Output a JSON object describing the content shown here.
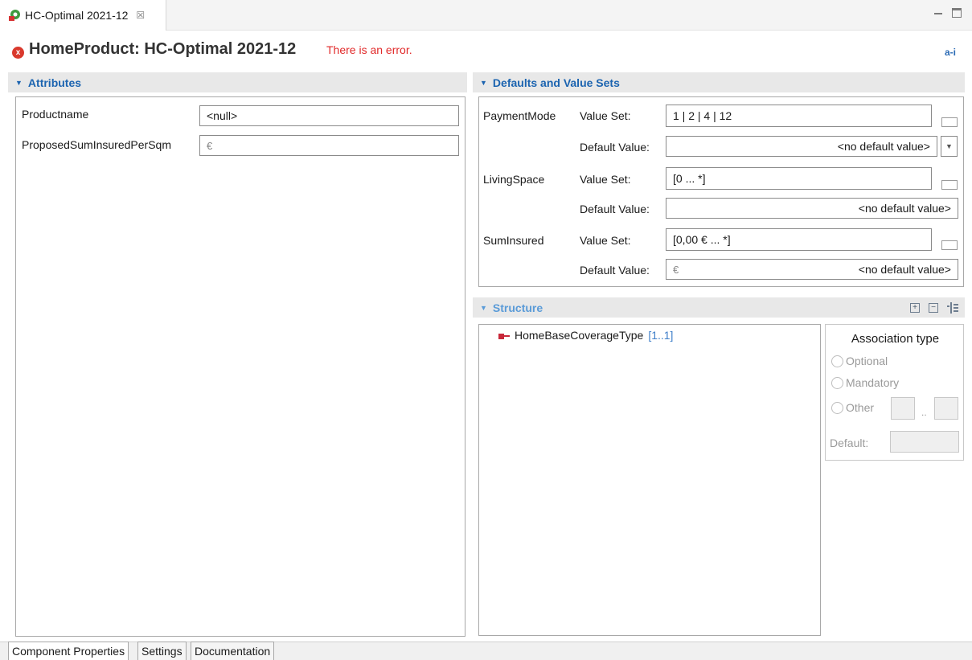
{
  "editor_tab": {
    "title": "HC-Optimal 2021-12",
    "close": "☒"
  },
  "header": {
    "title": "HomeProduct: HC-Optimal 2021-12",
    "error": "There is an error.",
    "error_icon": "x",
    "info_icon": "a-i"
  },
  "attributes": {
    "section_title": "Attributes",
    "rows": [
      {
        "label": "Productname",
        "value": "<null>",
        "unit": ""
      },
      {
        "label": "ProposedSumInsuredPerSqm",
        "value": "",
        "unit": "€"
      }
    ]
  },
  "defaults": {
    "section_title": "Defaults and Value Sets",
    "value_set_label": "Value Set:",
    "default_value_label": "Default Value:",
    "rows": [
      {
        "name": "PaymentMode",
        "value_set": "1 | 2 | 4 | 12",
        "default_value": "<no default value>",
        "default_unit": "",
        "has_dropdown": true
      },
      {
        "name": "LivingSpace",
        "value_set": "[0 ... *]",
        "default_value": "<no default value>",
        "default_unit": "",
        "has_dropdown": false
      },
      {
        "name": "SumInsured",
        "value_set": "[0,00 € ... *]",
        "default_value": "<no default value>",
        "default_unit": "€",
        "has_dropdown": false
      }
    ]
  },
  "structure": {
    "section_title": "Structure",
    "tree_item": {
      "name": "HomeBaseCoverageType",
      "cardinality": "[1..1]"
    },
    "association": {
      "title": "Association type",
      "options": [
        "Optional",
        "Mandatory",
        "Other"
      ],
      "range_sep": "..",
      "default_label": "Default:"
    }
  },
  "bottom_tabs": [
    "Component Properties",
    "Settings",
    "Documentation"
  ],
  "colors": {
    "accent": "#1c64b0",
    "error": "#e12a2a",
    "section_bg": "#e8e8e8"
  }
}
